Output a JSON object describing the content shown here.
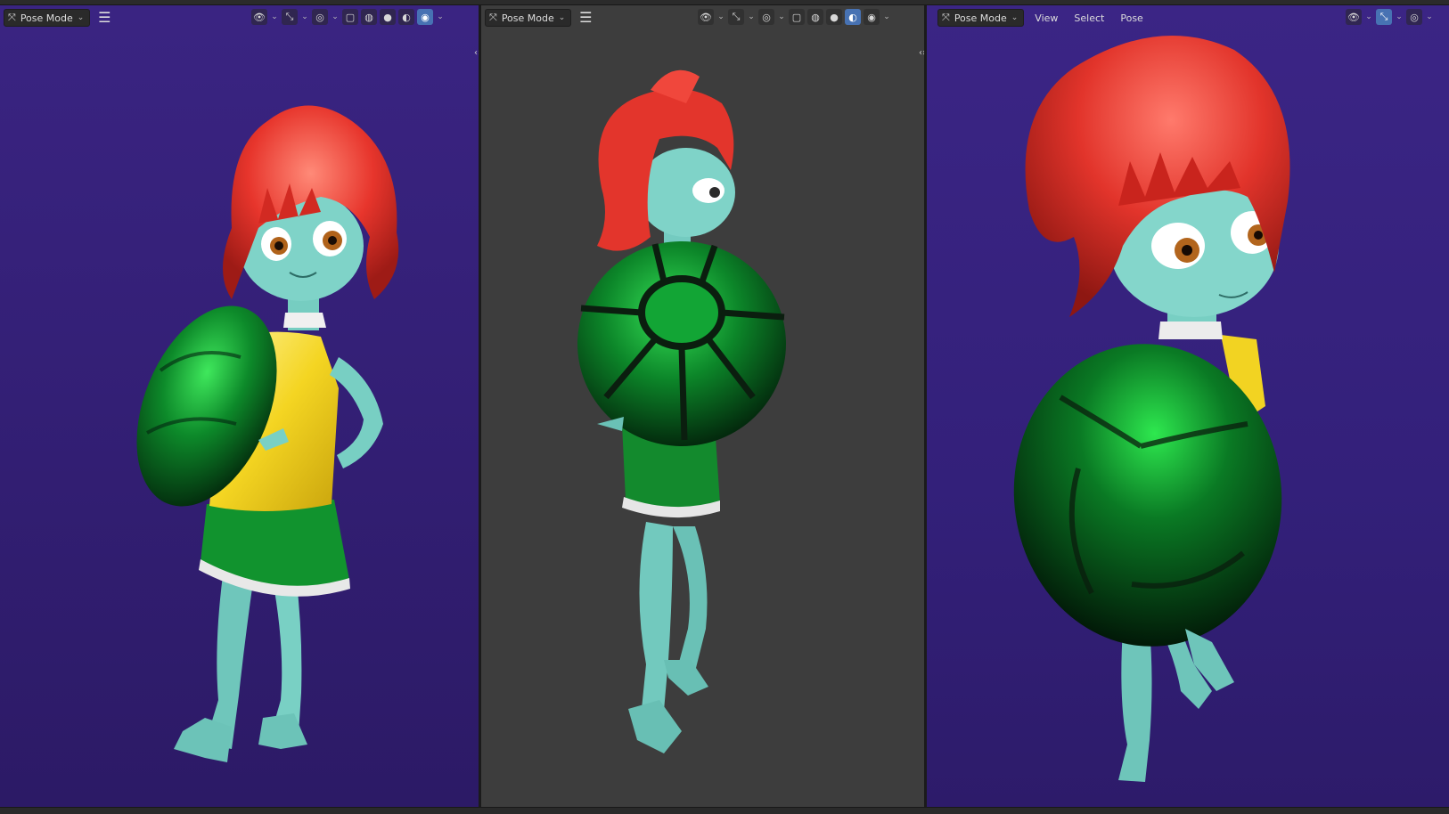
{
  "viewports": [
    {
      "id": "left",
      "mode": "Pose Mode",
      "menus": []
    },
    {
      "id": "middle",
      "mode": "Pose Mode",
      "menus": []
    },
    {
      "id": "right",
      "mode": "Pose Mode",
      "menus": [
        "View",
        "Select",
        "Pose"
      ]
    }
  ],
  "icons": {
    "menu": "hamburger-icon",
    "visibility": "eye-icon",
    "gizmo": "gizmo-icon",
    "overlay": "overlay-icon",
    "xray": "xray-icon",
    "wireframe": "wireframe-shading-icon",
    "solid": "solid-shading-icon",
    "material": "material-shading-icon",
    "rendered": "rendered-shading-icon"
  },
  "colors": {
    "accent": "#4772b3",
    "viewport_purple": "#35217a",
    "viewport_gray": "#3d3d3d",
    "skin": "#7fd3c8",
    "hair": "#e8342c",
    "shell": "#0f8a2c",
    "top": "#f2d322"
  }
}
